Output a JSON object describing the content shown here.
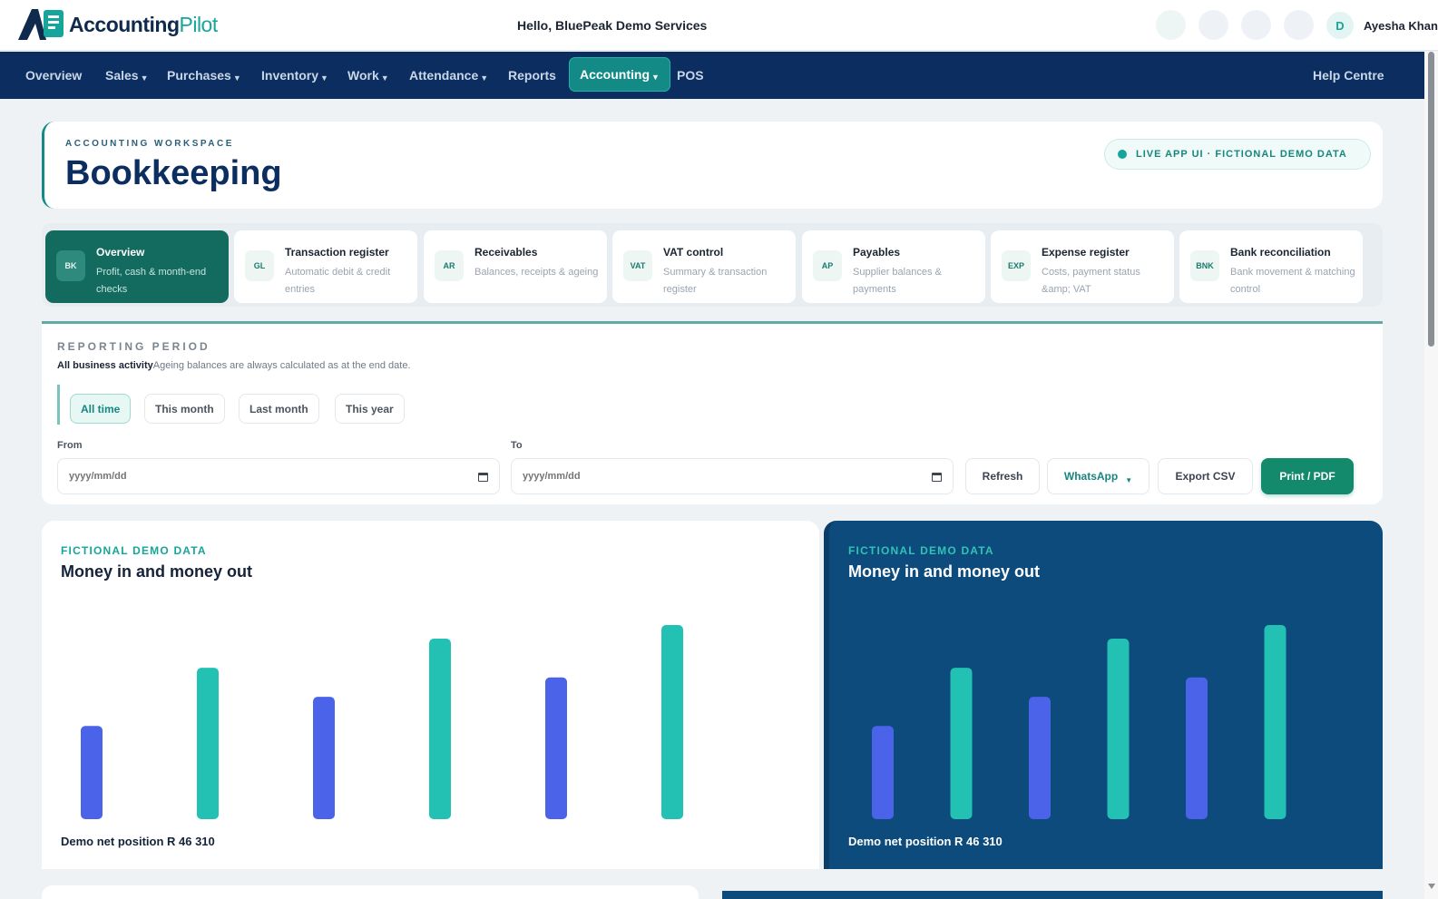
{
  "header": {
    "brand_primary": "Accounting",
    "brand_secondary": "Pilot",
    "greeting": "Hello, BluePeak Demo Services",
    "avatar_initial": "D",
    "user_name": "Ayesha Khan"
  },
  "nav": {
    "items": [
      {
        "label": "Overview",
        "caret": false
      },
      {
        "label": "Sales",
        "caret": true
      },
      {
        "label": "Purchases",
        "caret": true
      },
      {
        "label": "Inventory",
        "caret": true
      },
      {
        "label": "Work",
        "caret": true
      },
      {
        "label": "Attendance",
        "caret": true
      },
      {
        "label": "Reports",
        "caret": false
      },
      {
        "label": "Accounting",
        "caret": true,
        "active": true
      },
      {
        "label": "POS",
        "caret": false
      }
    ],
    "help": "Help Centre"
  },
  "page": {
    "eyebrow": "ACCOUNTING WORKSPACE",
    "title": "Bookkeeping",
    "live_pill": "LIVE APP UI · FICTIONAL DEMO DATA"
  },
  "modules": [
    {
      "badge": "BK",
      "title": "Overview",
      "subtitle": "Profit, cash & month-end checks",
      "active": true
    },
    {
      "badge": "GL",
      "title": "Transaction register",
      "subtitle": "Automatic debit & credit entries"
    },
    {
      "badge": "AR",
      "title": "Receivables",
      "subtitle": "Balances, receipts & ageing"
    },
    {
      "badge": "VAT",
      "title": "VAT control",
      "subtitle": "Summary & transaction register"
    },
    {
      "badge": "AP",
      "title": "Payables",
      "subtitle": "Supplier balances & payments"
    },
    {
      "badge": "EXP",
      "title": "Expense register",
      "subtitle": "Costs, payment status &amp; VAT"
    },
    {
      "badge": "BNK",
      "title": "Bank reconciliation",
      "subtitle": "Bank movement & matching control"
    }
  ],
  "period": {
    "eyebrow": "REPORTING PERIOD",
    "scope": "All business activity",
    "note": "Ageing balances are always calculated as at the end date.",
    "chips": [
      {
        "label": "All time",
        "active": true
      },
      {
        "label": "This month"
      },
      {
        "label": "Last month"
      },
      {
        "label": "This year"
      }
    ],
    "from_label": "From",
    "to_label": "To",
    "from_placeholder": "yyyy/mm/dd",
    "to_placeholder": "yyyy/mm/dd",
    "buttons": {
      "refresh": "Refresh",
      "whatsapp": "WhatsApp",
      "export": "Export CSV",
      "print": "Print / PDF"
    }
  },
  "cards": [
    {
      "eyebrow": "FICTIONAL DEMO DATA",
      "title": "Money in and money out",
      "footer": "Demo net position R 46 310",
      "theme": "light"
    },
    {
      "eyebrow": "FICTIONAL DEMO DATA",
      "title": "Money in and money out",
      "footer": "Demo net position R 46 310",
      "theme": "dark"
    }
  ],
  "chart_data": [
    {
      "type": "bar",
      "values": [
        48,
        78,
        63,
        93,
        73,
        100
      ],
      "colors": [
        "#4a63e8",
        "#23c1b3",
        "#4a63e8",
        "#23c1b3",
        "#4a63e8",
        "#23c1b3"
      ],
      "ylim": [
        0,
        100
      ],
      "grid": false
    },
    {
      "type": "bar",
      "values": [
        48,
        78,
        63,
        93,
        73,
        100
      ],
      "colors": [
        "#4a63e8",
        "#23c1b3",
        "#4a63e8",
        "#23c1b3",
        "#4a63e8",
        "#23c1b3"
      ],
      "ylim": [
        0,
        100
      ],
      "grid": false
    }
  ],
  "colors": {
    "nav_bg": "#0b2d5f",
    "accent": "#138a86",
    "bar_in": "#23c1b3",
    "bar_out": "#4a63e8"
  }
}
